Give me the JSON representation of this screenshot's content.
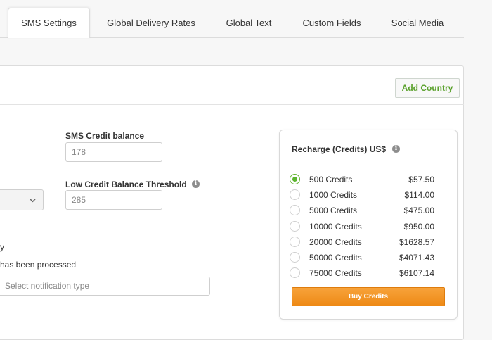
{
  "tabs": [
    {
      "label": "SMS Settings",
      "active": true
    },
    {
      "label": "Global Delivery Rates",
      "active": false
    },
    {
      "label": "Global Text",
      "active": false
    },
    {
      "label": "Custom Fields",
      "active": false
    },
    {
      "label": "Social Media",
      "active": false
    }
  ],
  "header": {
    "add_country_label": "Add Country"
  },
  "fields": {
    "credit_balance": {
      "label": "SMS Credit balance",
      "value": "178"
    },
    "low_threshold": {
      "label": "Low Credit Balance Threshold",
      "value": "285"
    }
  },
  "fragments": {
    "line1": "y",
    "line2": "has been processed"
  },
  "notification": {
    "placeholder": "Select notification type"
  },
  "recharge": {
    "title": "Recharge (Credits) US$",
    "options": [
      {
        "label": "500 Credits",
        "price": "$57.50",
        "selected": true
      },
      {
        "label": "1000 Credits",
        "price": "$114.00",
        "selected": false
      },
      {
        "label": "5000 Credits",
        "price": "$475.00",
        "selected": false
      },
      {
        "label": "10000 Credits",
        "price": "$950.00",
        "selected": false
      },
      {
        "label": "20000 Credits",
        "price": "$1628.57",
        "selected": false
      },
      {
        "label": "50000 Credits",
        "price": "$4071.43",
        "selected": false
      },
      {
        "label": "75000 Credits",
        "price": "$6107.14",
        "selected": false
      }
    ],
    "buy_label": "Buy Credits"
  },
  "colors": {
    "accent_green": "#5cb52f",
    "buy_orange": "#ee8a16"
  },
  "icons": {
    "info": "info-icon",
    "chevron": "chevron-down-icon"
  }
}
